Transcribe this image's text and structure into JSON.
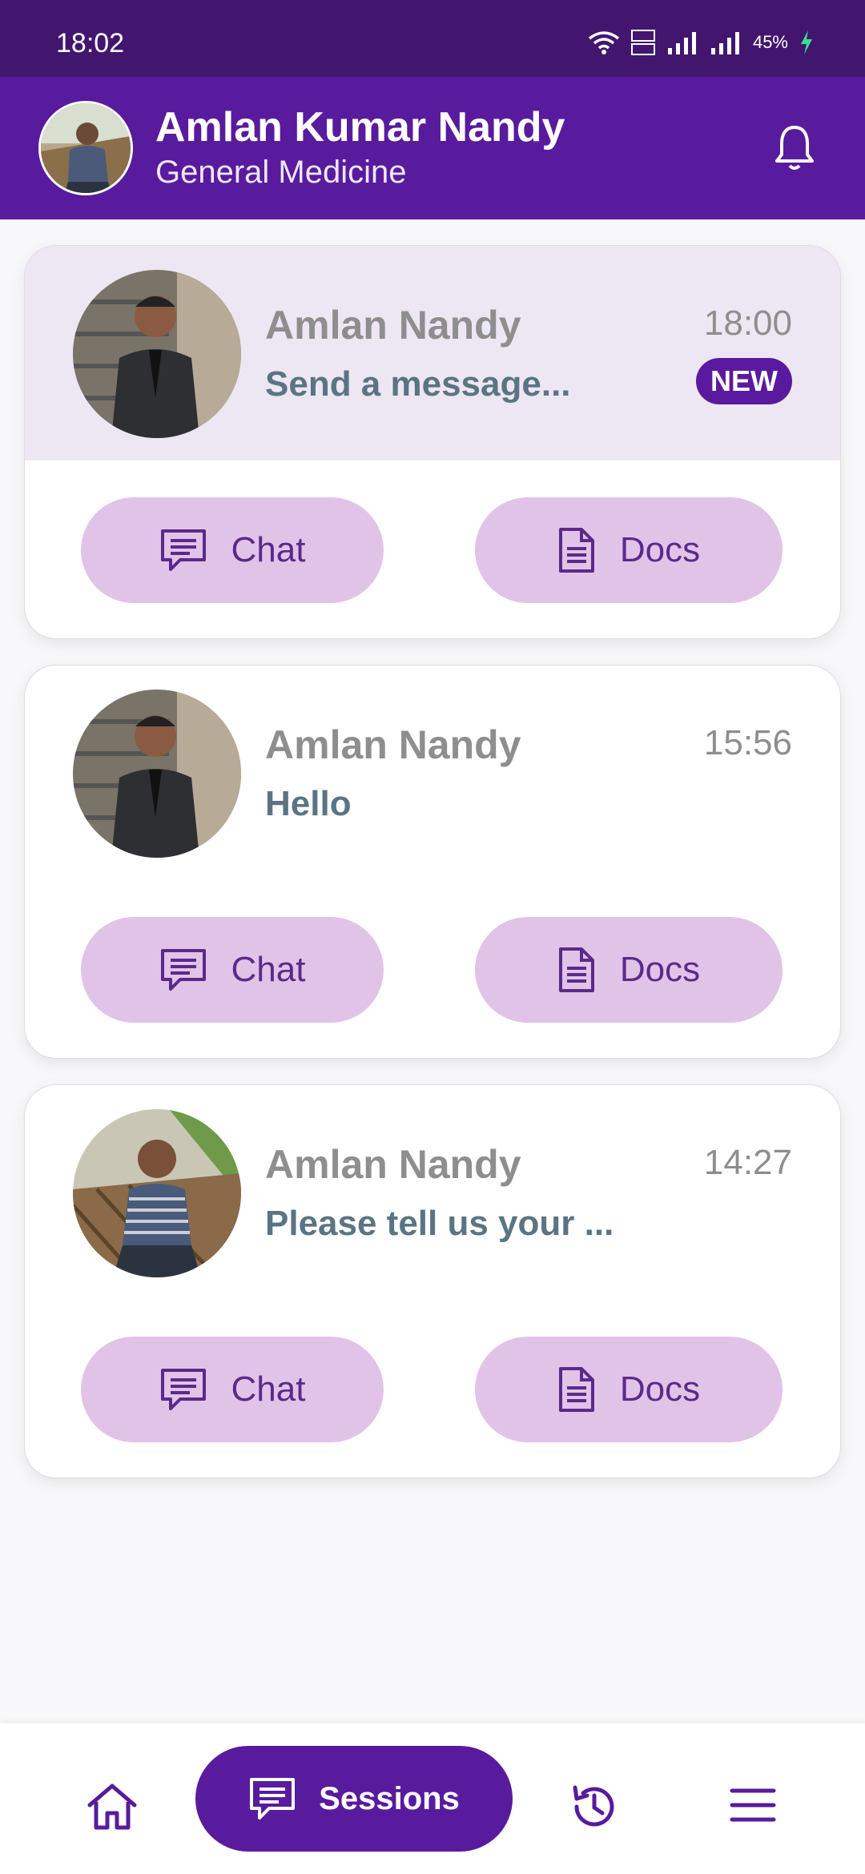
{
  "status_bar": {
    "time": "18:02",
    "battery": "45%"
  },
  "header": {
    "name": "Amlan Kumar Nandy",
    "subtitle": "General Medicine"
  },
  "sessions": [
    {
      "name": "Amlan Nandy",
      "time": "18:00",
      "message": "Send a message...",
      "badge": "NEW",
      "chat_label": "Chat",
      "docs_label": "Docs"
    },
    {
      "name": "Amlan Nandy",
      "time": "15:56",
      "message": "Hello",
      "chat_label": "Chat",
      "docs_label": "Docs"
    },
    {
      "name": "Amlan Nandy",
      "time": "14:27",
      "message": "Please tell us your ...",
      "chat_label": "Chat",
      "docs_label": "Docs"
    }
  ],
  "bottom_nav": {
    "active_label": "Sessions"
  },
  "icons": {
    "notification": "bell-icon",
    "chat": "chat-icon",
    "docs": "document-icon",
    "home": "home-icon",
    "history": "history-icon",
    "menu": "menu-icon"
  },
  "colors": {
    "status_bar": "#42166f",
    "primary": "#581b9e",
    "pill": "#e2c3e8",
    "highlight_card": "#ede6f3",
    "message_text": "#5b7483"
  }
}
